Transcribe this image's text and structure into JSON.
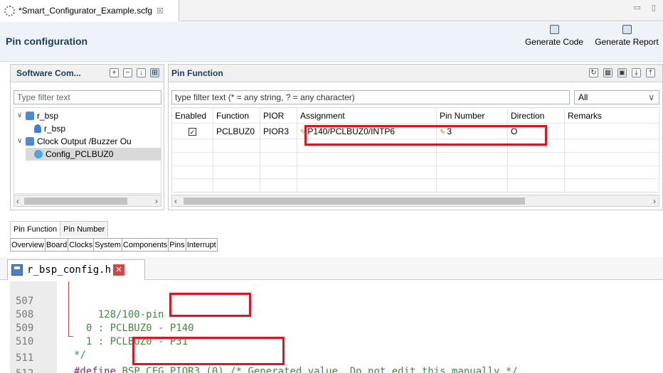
{
  "editor_tab": {
    "title": "*Smart_Configurator_Example.scfg",
    "close": "☒"
  },
  "window_controls": "▭ ▯",
  "header": {
    "title": "Pin configuration",
    "generate_code": "Generate Code",
    "generate_report": "Generate Report"
  },
  "software_components": {
    "title": "Software Com...",
    "filter_placeholder": "Type filter text",
    "tree": [
      {
        "label": "r_bsp",
        "level": 0,
        "expanded": true
      },
      {
        "label": "r_bsp",
        "level": 1
      },
      {
        "label": "Clock Output /Buzzer Ou",
        "level": 0,
        "expanded": true
      },
      {
        "label": "Config_PCLBUZ0",
        "level": 1,
        "selected": true
      }
    ]
  },
  "pin_function": {
    "title": "Pin Function",
    "filter_placeholder": "type filter text (* = any string, ? = any character)",
    "select_value": "All",
    "columns": [
      "Enabled",
      "Function",
      "PIOR",
      "Assignment",
      "Pin Number",
      "Direction",
      "Remarks"
    ],
    "rows": [
      {
        "enabled": true,
        "function": "PCLBUZ0",
        "pior": "PIOR3",
        "assignment": "P140/PCLBUZ0/INTP6",
        "pin_number": "3",
        "direction": "O",
        "remarks": ""
      }
    ]
  },
  "sub_tabs": [
    "Pin Function",
    "Pin Number"
  ],
  "page_tabs": [
    "Overview",
    "Board",
    "Clocks",
    "System",
    "Components",
    "Pins",
    "Interrupt"
  ],
  "code_tab": {
    "filename": "r_bsp_config.h"
  },
  "code_lines": [
    {
      "num": "507",
      "text": "    128/100-pin"
    },
    {
      "num": "508",
      "text": "  0 : PCLBUZ0 - P140"
    },
    {
      "num": "509",
      "text": "  1 : PCLBUZ0 - P31"
    },
    {
      "num": "510",
      "text": "*/"
    },
    {
      "num": "511",
      "text_kw": "#define",
      "text_rest": " BSP_CFG_PIOR3 (0)",
      "text_comment": " /* Generated value. Do not edit this manually */"
    },
    {
      "num": "512",
      "text": ""
    }
  ],
  "colors": {
    "highlight": "#e0141f",
    "comment": "#3f8a3f",
    "keyword": "#7f2d6b",
    "header_title": "#1f3a5f"
  }
}
